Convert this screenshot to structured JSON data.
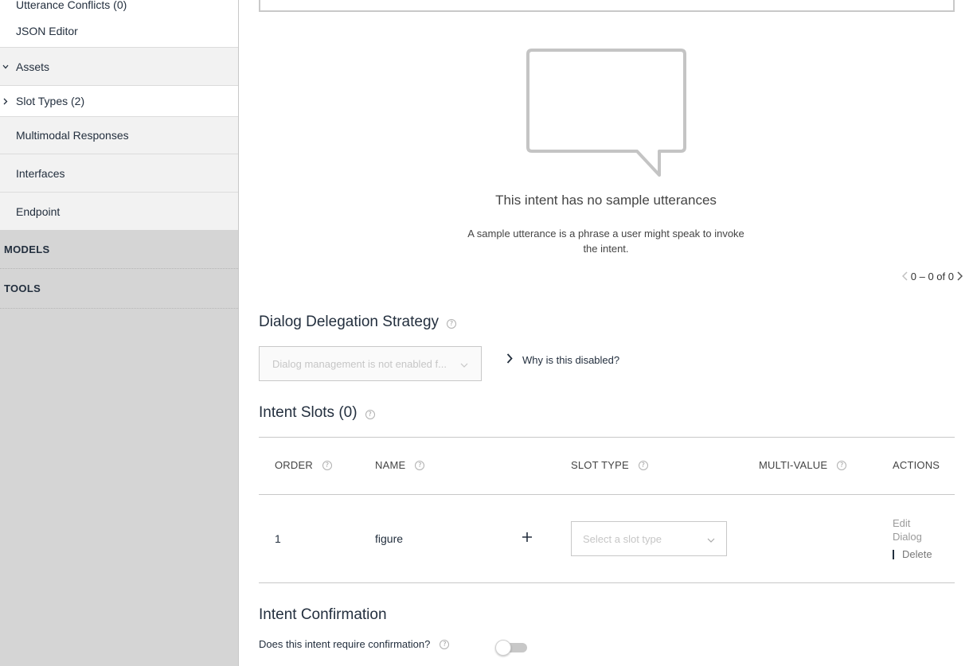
{
  "sidebar": {
    "items": [
      {
        "label": "Utterance Conflicts (0)"
      },
      {
        "label": "JSON Editor"
      },
      {
        "label": "Assets",
        "expanded": true
      },
      {
        "label": "Slot Types (2)",
        "expanded": false
      },
      {
        "label": "Multimodal Responses"
      },
      {
        "label": "Interfaces"
      },
      {
        "label": "Endpoint"
      }
    ],
    "sections": [
      {
        "label": "MODELS"
      },
      {
        "label": "TOOLS"
      }
    ]
  },
  "utterances": {
    "empty_title": "This intent has no sample utterances",
    "empty_description": "A sample utterance is a phrase a user might speak to invoke the intent.",
    "pagination": "0 – 0 of 0"
  },
  "dialog_delegation": {
    "title": "Dialog Delegation Strategy",
    "select_text": "Dialog management is not enabled f...",
    "why_link": "Why is this disabled?"
  },
  "intent_slots": {
    "title": "Intent Slots (0)",
    "columns": [
      "ORDER",
      "NAME",
      "SLOT TYPE",
      "MULTI-VALUE",
      "ACTIONS"
    ],
    "rows": [
      {
        "order": "1",
        "name": "figure",
        "slot_type_placeholder": "Select a slot type",
        "edit_dialog": "Edit Dialog",
        "delete": "Delete"
      }
    ]
  },
  "intent_confirmation": {
    "title": "Intent Confirmation",
    "question": "Does this intent require confirmation?",
    "enabled": false
  },
  "help_icon_text": "?",
  "colors": {
    "sidebar_bg": "#d5d5d5",
    "sidebar_item_bg": "#f2f2f2",
    "text_primary": "#232f3e",
    "border": "#c8c8c8"
  }
}
